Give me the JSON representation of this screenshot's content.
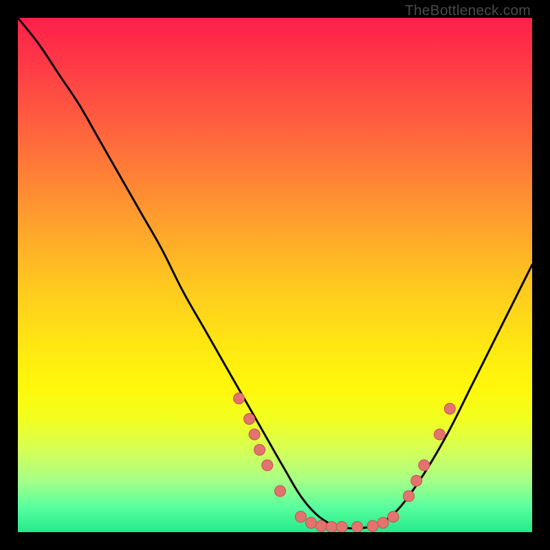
{
  "watermark": "TheBottleneck.com",
  "colors": {
    "background": "#000000",
    "curve": "#000000",
    "marker_fill": "#e2736f",
    "marker_stroke": "#c94f4b"
  },
  "chart_data": {
    "type": "line",
    "title": "",
    "xlabel": "",
    "ylabel": "",
    "xlim": [
      0,
      100
    ],
    "ylim": [
      0,
      100
    ],
    "grid": false,
    "legend": false,
    "series": [
      {
        "name": "bottleneck-curve",
        "x": [
          0,
          4,
          8,
          12,
          16,
          20,
          24,
          28,
          32,
          36,
          40,
          44,
          48,
          52,
          55,
          58,
          61,
          64,
          67,
          70,
          73,
          76,
          80,
          84,
          88,
          92,
          96,
          100
        ],
        "y": [
          100,
          95,
          89,
          83,
          76,
          69,
          62,
          55,
          47,
          40,
          33,
          26,
          19,
          12,
          7,
          3.5,
          1.5,
          0.8,
          0.8,
          1.5,
          3.5,
          7,
          13,
          20,
          28,
          36,
          44,
          52
        ]
      }
    ],
    "markers": [
      {
        "x": 43,
        "y": 26
      },
      {
        "x": 45,
        "y": 22
      },
      {
        "x": 46,
        "y": 19
      },
      {
        "x": 47,
        "y": 16
      },
      {
        "x": 48.5,
        "y": 13
      },
      {
        "x": 51,
        "y": 8
      },
      {
        "x": 55,
        "y": 3
      },
      {
        "x": 57,
        "y": 1.8
      },
      {
        "x": 59,
        "y": 1.2
      },
      {
        "x": 61,
        "y": 1
      },
      {
        "x": 63,
        "y": 1
      },
      {
        "x": 66,
        "y": 1
      },
      {
        "x": 69,
        "y": 1.2
      },
      {
        "x": 71,
        "y": 1.8
      },
      {
        "x": 73,
        "y": 3
      },
      {
        "x": 76,
        "y": 7
      },
      {
        "x": 77.5,
        "y": 10
      },
      {
        "x": 79,
        "y": 13
      },
      {
        "x": 82,
        "y": 19
      },
      {
        "x": 84,
        "y": 24
      }
    ]
  }
}
